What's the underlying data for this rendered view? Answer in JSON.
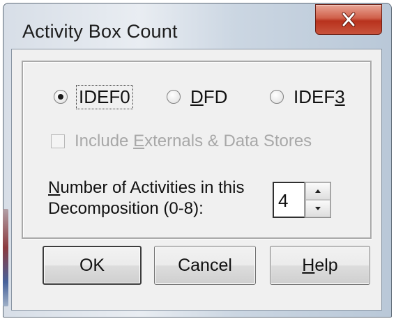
{
  "window": {
    "title": "Activity Box Count",
    "close_icon": "close-icon"
  },
  "diagram_type": {
    "options": [
      {
        "label_pre": "IDEF0",
        "label_u": "",
        "label_post": "",
        "checked": true
      },
      {
        "label_pre": "",
        "label_u": "D",
        "label_post": "FD",
        "checked": false
      },
      {
        "label_pre": "IDEF",
        "label_u": "3",
        "label_post": "",
        "checked": false
      }
    ]
  },
  "include_externals": {
    "label_pre": "Include ",
    "label_u": "E",
    "label_post": "xternals & Data Stores",
    "checked": false,
    "enabled": false
  },
  "activity_count": {
    "label_u": "N",
    "label_line1_rest": "umber of Activities in this",
    "label_line2": "Decomposition (0-8):",
    "value": "4"
  },
  "buttons": {
    "ok": "OK",
    "cancel": "Cancel",
    "help_u": "H",
    "help_rest": "elp"
  },
  "colors": {
    "close_button": "#c8533c",
    "dialog_background": "#f0f0f0",
    "disabled_text": "#a8a8a8"
  }
}
